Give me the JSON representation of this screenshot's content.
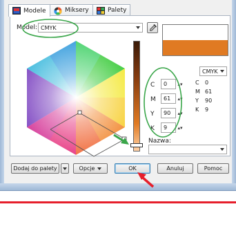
{
  "tabs": [
    {
      "label": "Modele",
      "icon": "models-icon"
    },
    {
      "label": "Miksery",
      "icon": "mixers-icon"
    },
    {
      "label": "Palety",
      "icon": "palettes-icon"
    }
  ],
  "model": {
    "label": "Model:",
    "value": "CMYK"
  },
  "components": [
    {
      "key": "C",
      "value": "0"
    },
    {
      "key": "M",
      "value": "61"
    },
    {
      "key": "Y",
      "value": "90"
    },
    {
      "key": "K",
      "value": "9"
    }
  ],
  "reference": {
    "model": "CMYK",
    "values": [
      {
        "key": "C",
        "value": "0"
      },
      {
        "key": "M",
        "value": "61"
      },
      {
        "key": "Y",
        "value": "90"
      },
      {
        "key": "K",
        "value": "9"
      }
    ]
  },
  "name_label": "Nazwa:",
  "colors": {
    "current": "#e07a22",
    "reference": "#ffffff",
    "annotation_green": "#3aa64a",
    "annotation_red": "#e61e2b"
  },
  "buttons": {
    "add_to_palette": "Dodaj do palety",
    "options": "Opcje",
    "ok": "OK",
    "cancel": "Anuluj",
    "help": "Pomoc"
  }
}
